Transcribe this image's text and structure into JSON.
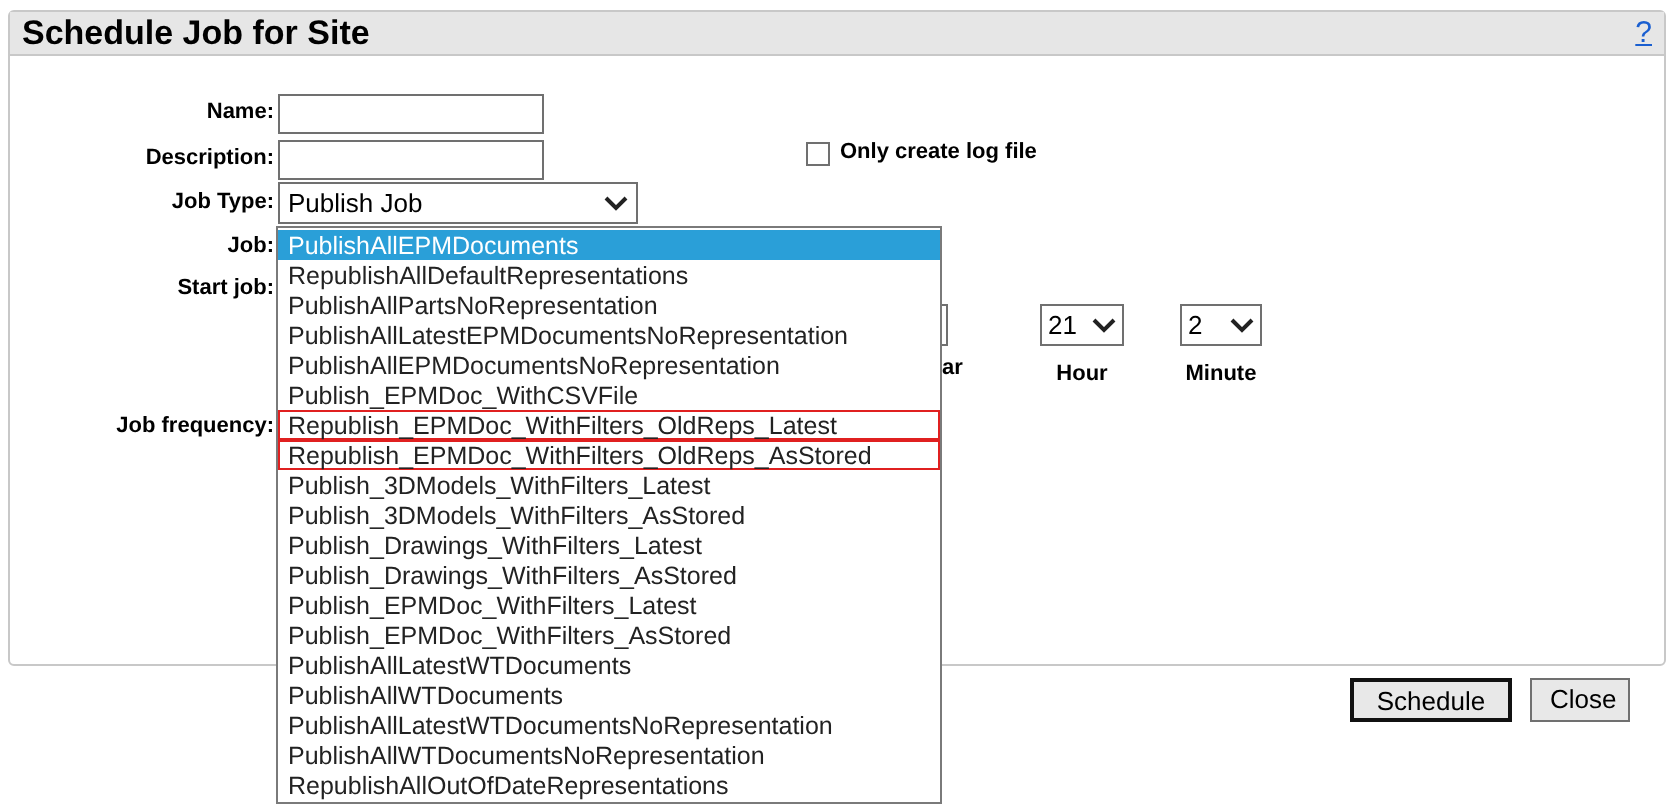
{
  "window": {
    "title": "Schedule Job for Site",
    "help": "?"
  },
  "form": {
    "name_label": "Name:",
    "description_label": "Description:",
    "job_type_label": "Job Type:",
    "job_type_value": "Publish Job",
    "job_label": "Job:",
    "start_label": "Start job:",
    "frequency_label": "Job frequency:"
  },
  "log_option": {
    "label": "Only create log file",
    "checked": false
  },
  "time": {
    "year_label_visible": "ar",
    "hour_value": "21",
    "hour_label": "Hour",
    "minute_value": "2",
    "minute_label": "Minute"
  },
  "job_list": [
    {
      "label": "PublishAllEPMDocuments",
      "selected": true,
      "highlighted": false
    },
    {
      "label": "RepublishAllDefaultRepresentations",
      "selected": false,
      "highlighted": false
    },
    {
      "label": "PublishAllPartsNoRepresentation",
      "selected": false,
      "highlighted": false
    },
    {
      "label": "PublishAllLatestEPMDocumentsNoRepresentation",
      "selected": false,
      "highlighted": false
    },
    {
      "label": "PublishAllEPMDocumentsNoRepresentation",
      "selected": false,
      "highlighted": false
    },
    {
      "label": "Publish_EPMDoc_WithCSVFile",
      "selected": false,
      "highlighted": false
    },
    {
      "label": "Republish_EPMDoc_WithFilters_OldReps_Latest",
      "selected": false,
      "highlighted": true
    },
    {
      "label": "Republish_EPMDoc_WithFilters_OldReps_AsStored",
      "selected": false,
      "highlighted": true
    },
    {
      "label": "Publish_3DModels_WithFilters_Latest",
      "selected": false,
      "highlighted": false
    },
    {
      "label": "Publish_3DModels_WithFilters_AsStored",
      "selected": false,
      "highlighted": false
    },
    {
      "label": "Publish_Drawings_WithFilters_Latest",
      "selected": false,
      "highlighted": false
    },
    {
      "label": "Publish_Drawings_WithFilters_AsStored",
      "selected": false,
      "highlighted": false
    },
    {
      "label": "Publish_EPMDoc_WithFilters_Latest",
      "selected": false,
      "highlighted": false
    },
    {
      "label": "Publish_EPMDoc_WithFilters_AsStored",
      "selected": false,
      "highlighted": false
    },
    {
      "label": "PublishAllLatestWTDocuments",
      "selected": false,
      "highlighted": false
    },
    {
      "label": "PublishAllWTDocuments",
      "selected": false,
      "highlighted": false
    },
    {
      "label": "PublishAllLatestWTDocumentsNoRepresentation",
      "selected": false,
      "highlighted": false
    },
    {
      "label": "PublishAllWTDocumentsNoRepresentation",
      "selected": false,
      "highlighted": false
    },
    {
      "label": "RepublishAllOutOfDateRepresentations",
      "selected": false,
      "highlighted": false
    }
  ],
  "buttons": [
    {
      "label": "Schedule",
      "default": true
    },
    {
      "label": "Close",
      "default": false
    }
  ]
}
